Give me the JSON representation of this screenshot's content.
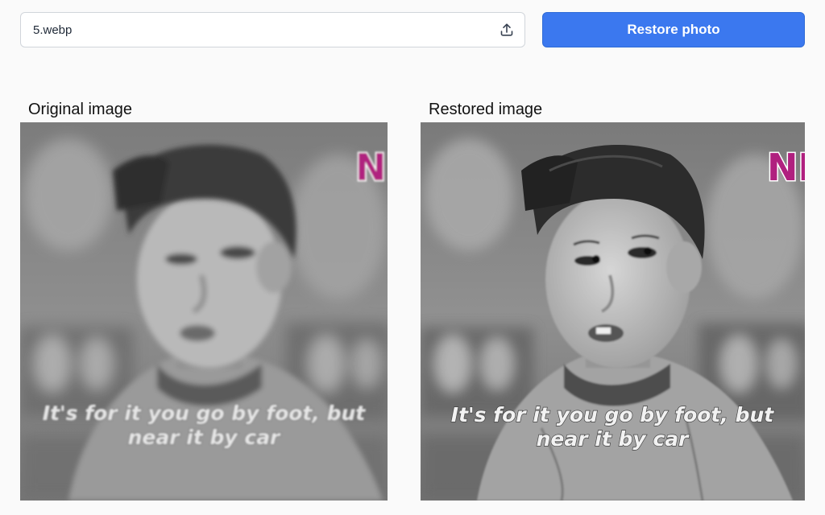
{
  "upload": {
    "file_name": "5.webp",
    "icon": "upload-icon"
  },
  "actions": {
    "restore_label": "Restore photo"
  },
  "panels": {
    "original": {
      "label": "Original image",
      "subtitle_line1": "It's for it you go by foot, but",
      "subtitle_line2": "near it by car",
      "logo_text": "NM"
    },
    "restored": {
      "label": "Restored image",
      "subtitle_line1": "It's for it you go by foot, but",
      "subtitle_line2": "near it by car",
      "logo_text": "NM"
    }
  },
  "colors": {
    "primary_button": "#3b78ef",
    "logo_magenta": "#b0207f",
    "logo_green": "#1fa84a"
  }
}
